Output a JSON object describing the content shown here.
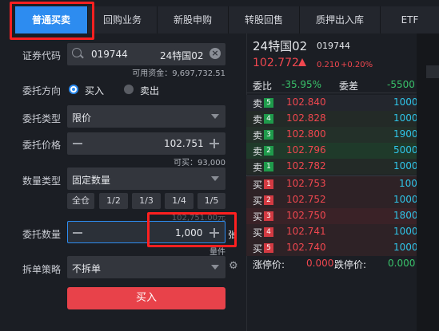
{
  "tabs": [
    {
      "label": "普通买卖",
      "active": true
    },
    {
      "label": "回购业务",
      "active": false
    },
    {
      "label": "新股申购",
      "active": false
    },
    {
      "label": "转股回售",
      "active": false
    },
    {
      "label": "质押出入库",
      "active": false
    },
    {
      "label": "ETF",
      "active": false
    }
  ],
  "form": {
    "code_label": "证券代码",
    "code_value": "019744",
    "code_name": "24特国02",
    "available_funds": "可用资金：9,697,732.51",
    "direction_label": "委托方向",
    "buy_label": "买入",
    "sell_label": "卖出",
    "order_type_label": "委托类型",
    "order_type_value": "限价",
    "price_label": "委托价格",
    "price_value": "102.751",
    "buyable": "可买：93,000",
    "qty_type_label": "数量类型",
    "qty_type_value": "固定数量",
    "qty_buttons": [
      "全仓",
      "1/2",
      "1/3",
      "1/4",
      "1/5"
    ],
    "qty_faint": "102,751.00元",
    "qty_label": "委托数量",
    "qty_value": "1,000",
    "qty_unit": "张",
    "qty_note": "量件",
    "split_label": "拆单策略",
    "split_value": "不拆单",
    "submit_label": "买入"
  },
  "quote": {
    "name": "24特国02",
    "code": "019744",
    "price": "102.772",
    "change": "0.210",
    "change_pct": "+0.20%",
    "weibi_label": "委比",
    "weibi_value": "-35.95%",
    "weicha_label": "委差",
    "weicha_value": "-5500",
    "asks": [
      {
        "side": "卖",
        "level": "5",
        "price": "102.840",
        "volume": "1000"
      },
      {
        "side": "卖",
        "level": "4",
        "price": "102.828",
        "volume": "1000"
      },
      {
        "side": "卖",
        "level": "3",
        "price": "102.800",
        "volume": "1900"
      },
      {
        "side": "卖",
        "level": "2",
        "price": "102.796",
        "volume": "5000"
      },
      {
        "side": "卖",
        "level": "1",
        "price": "102.782",
        "volume": "1000"
      }
    ],
    "bids": [
      {
        "side": "买",
        "level": "1",
        "price": "102.753",
        "volume": "100"
      },
      {
        "side": "买",
        "level": "2",
        "price": "102.752",
        "volume": "1000"
      },
      {
        "side": "买",
        "level": "3",
        "price": "102.750",
        "volume": "1800"
      },
      {
        "side": "买",
        "level": "4",
        "price": "102.741",
        "volume": "1000"
      },
      {
        "side": "买",
        "level": "5",
        "price": "102.740",
        "volume": "1000"
      }
    ],
    "limit_up_label": "涨停价:",
    "limit_up_value": "0.000",
    "limit_down_label": "跌停价:",
    "limit_down_value": "0.000"
  },
  "colors": {
    "accent": "#2d8cf0",
    "up": "#f0474f",
    "down": "#39c26a",
    "highlight": "#ff2020"
  }
}
